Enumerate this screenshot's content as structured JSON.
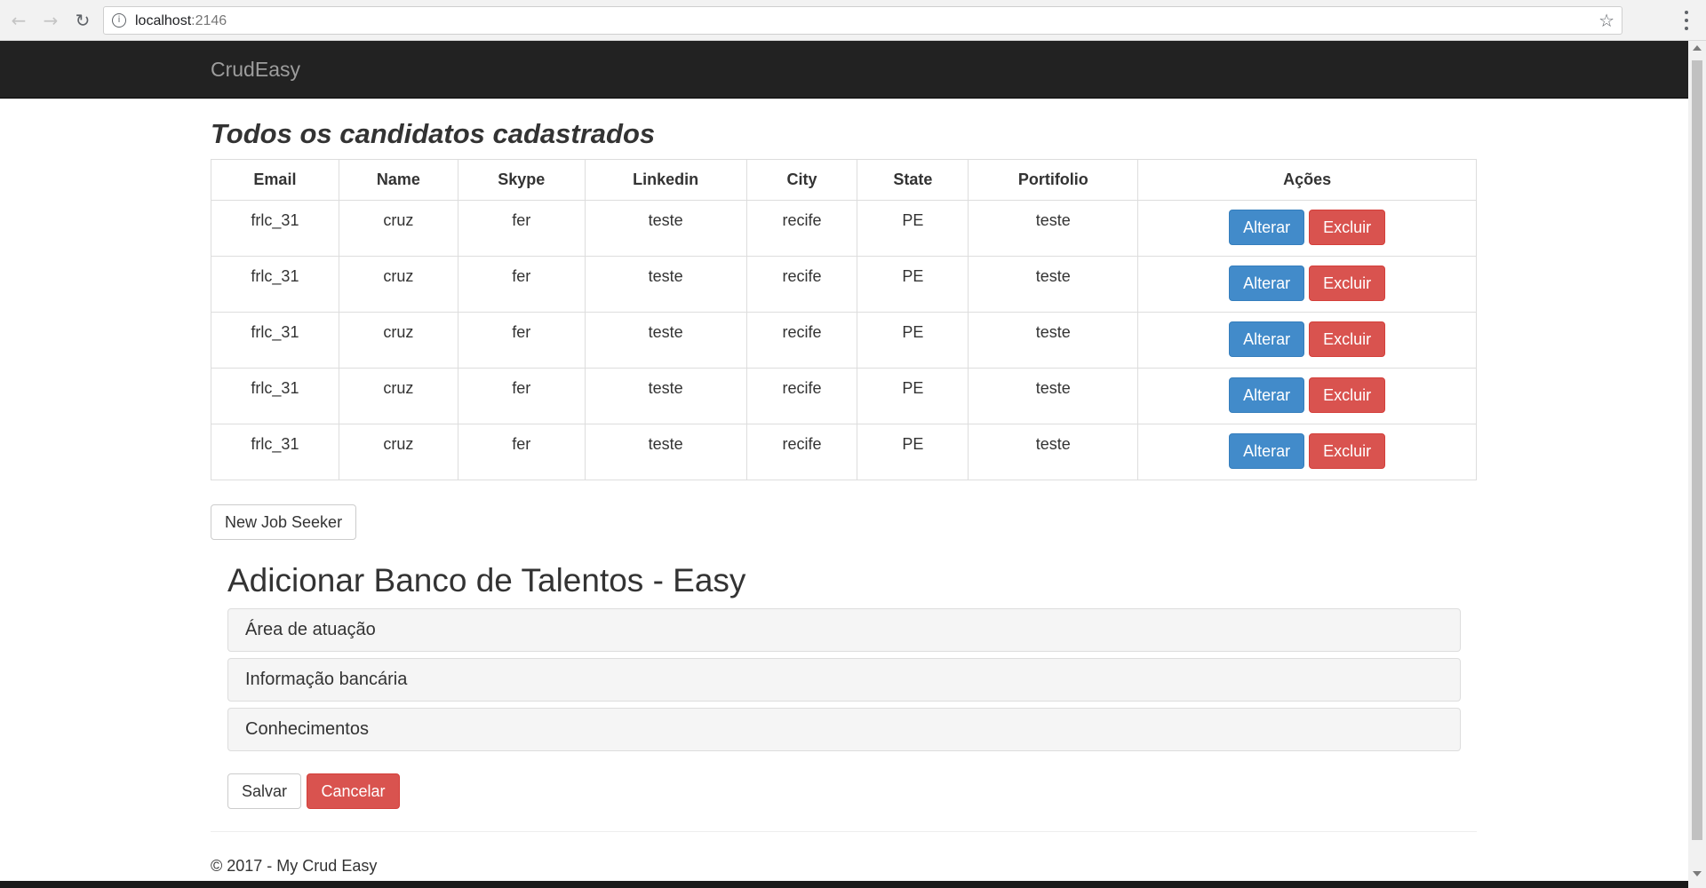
{
  "browser": {
    "url_host": "localhost",
    "url_port": ":2146",
    "back_icon": "arrow-left-icon",
    "forward_icon": "arrow-right-icon",
    "reload_icon": "reload-icon",
    "info_icon": "info-icon",
    "star_icon": "star-icon",
    "menu_icon": "kebab-menu-icon"
  },
  "navbar": {
    "brand": "CrudEasy"
  },
  "list": {
    "title": "Todos os candidatos cadastrados",
    "columns": [
      "Email",
      "Name",
      "Skype",
      "Linkedin",
      "City",
      "State",
      "Portifolio",
      "Ações"
    ],
    "rows": [
      {
        "email": "frlc_31",
        "name": "cruz",
        "skype": "fer",
        "linkedin": "teste",
        "city": "recife",
        "state": "PE",
        "portfolio": "teste"
      },
      {
        "email": "frlc_31",
        "name": "cruz",
        "skype": "fer",
        "linkedin": "teste",
        "city": "recife",
        "state": "PE",
        "portfolio": "teste"
      },
      {
        "email": "frlc_31",
        "name": "cruz",
        "skype": "fer",
        "linkedin": "teste",
        "city": "recife",
        "state": "PE",
        "portfolio": "teste"
      },
      {
        "email": "frlc_31",
        "name": "cruz",
        "skype": "fer",
        "linkedin": "teste",
        "city": "recife",
        "state": "PE",
        "portfolio": "teste"
      },
      {
        "email": "frlc_31",
        "name": "cruz",
        "skype": "fer",
        "linkedin": "teste",
        "city": "recife",
        "state": "PE",
        "portfolio": "teste"
      }
    ],
    "edit_label": "Alterar",
    "delete_label": "Excluir",
    "new_button": "New Job Seeker"
  },
  "form": {
    "title": "Adicionar Banco de Talentos - Easy",
    "sections": [
      "Área de atuação",
      "Informação bancária",
      "Conhecimentos"
    ],
    "save_label": "Salvar",
    "cancel_label": "Cancelar"
  },
  "footer": {
    "text": "© 2017 - My Crud Easy"
  },
  "colors": {
    "navbar": "#222222",
    "primary": "#428bca",
    "danger": "#d9534f"
  }
}
